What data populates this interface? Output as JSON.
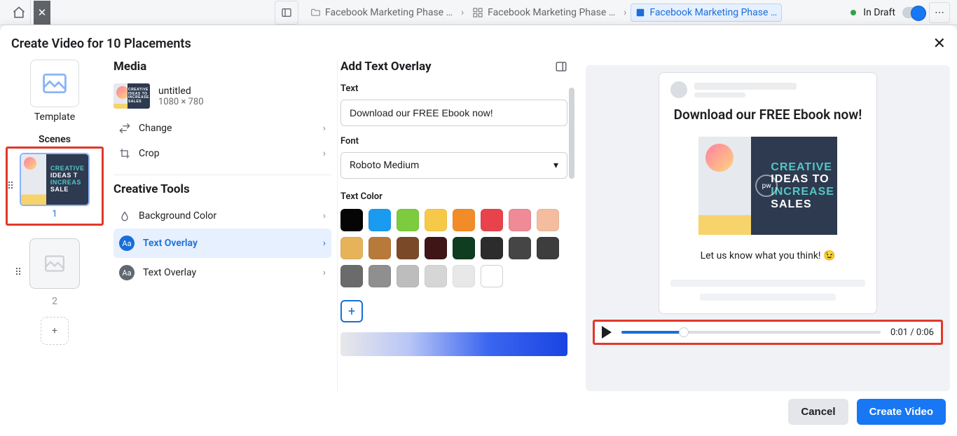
{
  "chrome": {
    "breadcrumb": [
      "Facebook Marketing Phase …",
      "Facebook Marketing Phase …",
      "Facebook Marketing Phase …"
    ],
    "status": "In Draft",
    "tab_label": "Facebook Marketing Phas…"
  },
  "modal": {
    "title": "Create Video for 10 Placements",
    "footer": {
      "cancel": "Cancel",
      "create": "Create Video"
    }
  },
  "left": {
    "template_label": "Template",
    "scenes_label": "Scenes",
    "scene_1": "1",
    "scene_2": "2"
  },
  "media": {
    "heading": "Media",
    "title": "untitled",
    "dimensions": "1080 × 780",
    "change": "Change",
    "crop": "Crop",
    "tools_heading": "Creative Tools",
    "bg_color": "Background Color",
    "text_overlay_active": "Text Overlay",
    "text_overlay": "Text Overlay"
  },
  "overlay": {
    "heading": "Add Text Overlay",
    "text_label": "Text",
    "text_value": "Download our FREE Ebook now!",
    "font_label": "Font",
    "font_value": "Roboto Medium",
    "color_label": "Text Color",
    "swatches": [
      "#050505",
      "#1a9bf0",
      "#7dcb3f",
      "#f7c948",
      "#f28c28",
      "#e8434c",
      "#ef8a97",
      "#f4bda0",
      "#e6b35a",
      "#b87a3a",
      "#7a4a28",
      "#3f1515",
      "#0f3d1f",
      "#2c2c2c",
      "#454545",
      "#3d3d3d",
      "#6b6b6b",
      "#8f8f8f",
      "#bdbdbd",
      "#d6d6d6",
      "#e8e8e8",
      "#ffffff"
    ]
  },
  "preview": {
    "headline": "Download our FREE Ebook now!",
    "caption": "Let us know what you think! 😉",
    "time_current": "0:01",
    "time_total": "0:06",
    "creative_lines": [
      "CREATIVE",
      "IDEAS TO",
      "INCREASE",
      "SALES"
    ]
  }
}
